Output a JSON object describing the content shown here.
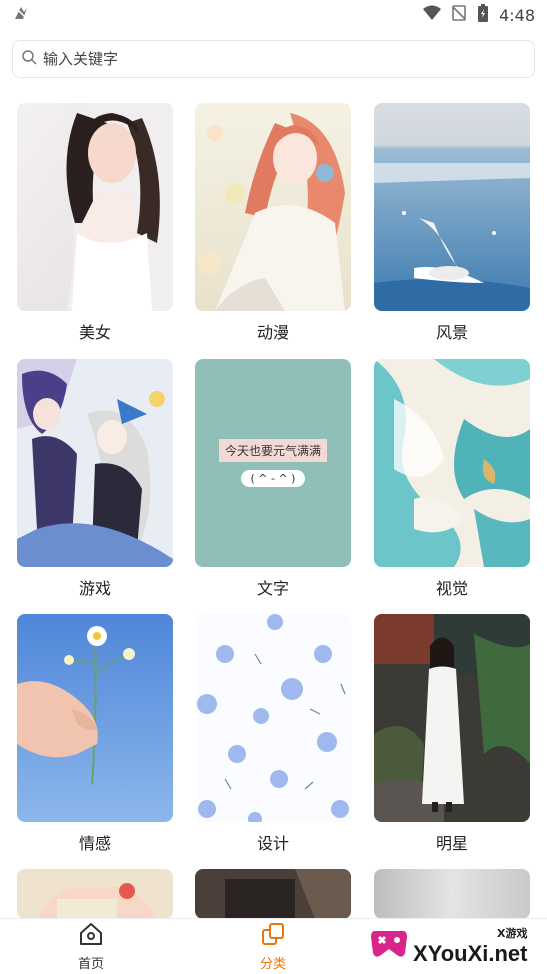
{
  "status": {
    "time": "4:48"
  },
  "search": {
    "placeholder": "输入关键字",
    "value": ""
  },
  "categories": [
    {
      "label": "美女"
    },
    {
      "label": "动漫"
    },
    {
      "label": "风景"
    },
    {
      "label": "游戏"
    },
    {
      "label": "文字"
    },
    {
      "label": "视觉"
    },
    {
      "label": "情感"
    },
    {
      "label": "设计"
    },
    {
      "label": "明星"
    }
  ],
  "text_card": {
    "line1": "今天也要元气满满",
    "line2": "( ^ - ^ )"
  },
  "tabs": [
    {
      "label": "首页",
      "active": false
    },
    {
      "label": "分类",
      "active": true
    }
  ],
  "watermark": {
    "small": "X游戏",
    "big": "XYouXi.net"
  },
  "colors": {
    "accent": "#e8750e",
    "text": "#222222",
    "inactive": "#333333"
  }
}
